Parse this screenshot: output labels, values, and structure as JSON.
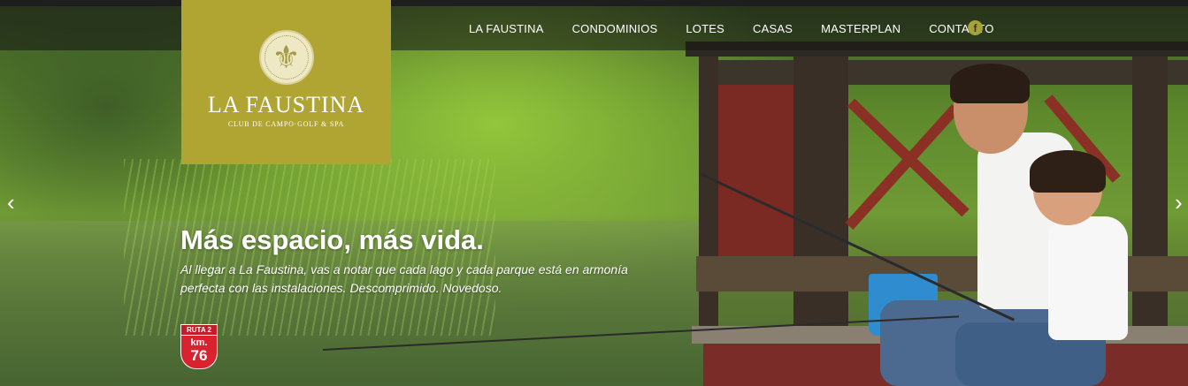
{
  "nav": {
    "items": [
      {
        "label": "LA FAUSTINA"
      },
      {
        "label": "CONDOMINIOS"
      },
      {
        "label": "LOTES"
      },
      {
        "label": "CASAS"
      },
      {
        "label": "MASTERPLAN"
      },
      {
        "label": "CONTACTO"
      }
    ],
    "social_icon": "facebook-icon",
    "social_glyph": "f"
  },
  "logo": {
    "title": "LA FAUSTINA",
    "subtitle": "CLUB DE CAMPO·GOLF & SPA",
    "emblem_icon": "fleur-de-lis-icon",
    "emblem_glyph": "⚜",
    "box_color": "#b0a532"
  },
  "slider": {
    "prev_glyph": "‹",
    "next_glyph": "›"
  },
  "hero": {
    "headline": "Más espacio, más vida.",
    "description": "Al llegar a La Faustina, vas a notar que cada lago y cada parque está en armonía perfecta con las instalaciones. Descomprimido. Novedoso."
  },
  "route_badge": {
    "top": "RUTA 2",
    "unit": "km.",
    "number": "76",
    "color": "#d8232f"
  }
}
